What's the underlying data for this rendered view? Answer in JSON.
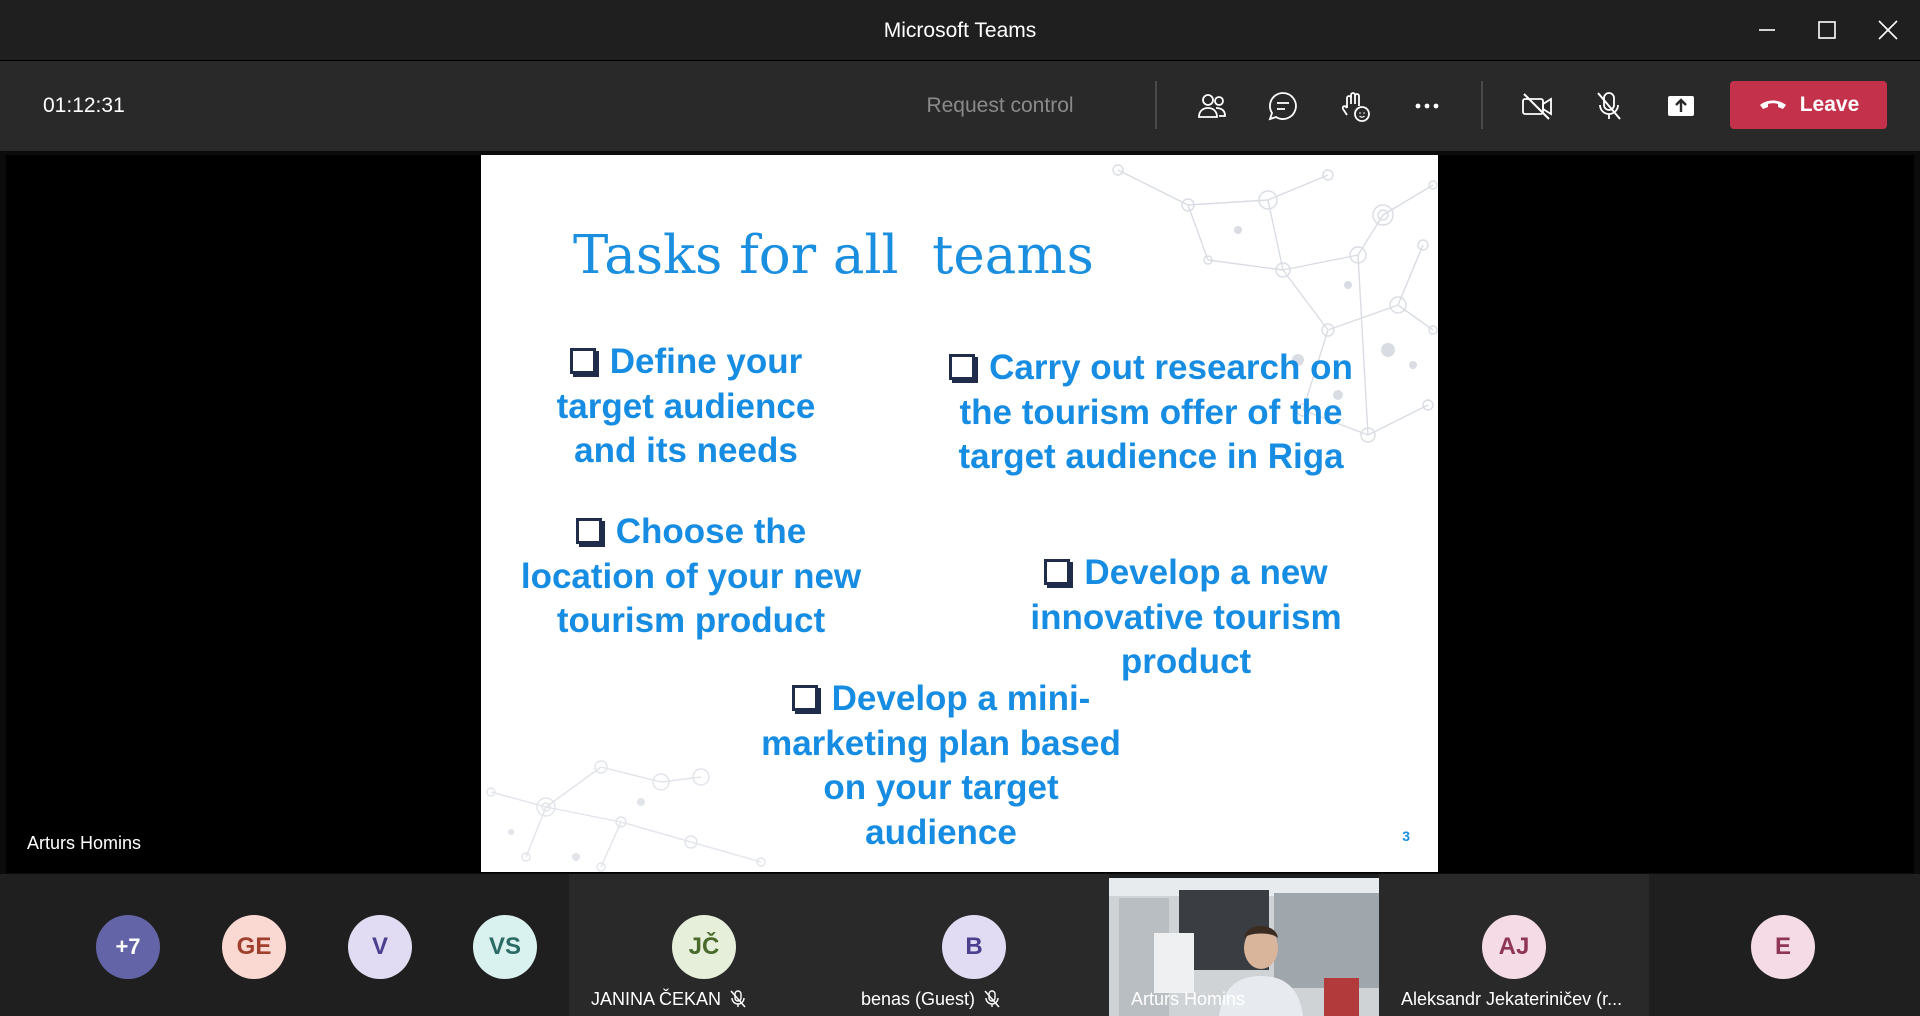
{
  "window": {
    "title": "Microsoft Teams"
  },
  "toolbar": {
    "timer": "01:12:31",
    "request_control": "Request control",
    "leave_label": "Leave",
    "icons": [
      "participants-icon",
      "chat-icon",
      "reactions-icon",
      "more-icon",
      "camera-off-icon",
      "mic-off-icon",
      "share-icon",
      "phone-icon"
    ]
  },
  "stage": {
    "presenter_name": "Arturs Homins"
  },
  "slide": {
    "title": "Tasks for all  teams",
    "tasks": [
      "Define your target audience and its needs",
      "Carry out research on the tourism offer of the target audience in Riga",
      "Choose the location of your new tourism product",
      "Develop a new innovative tourism product",
      "Develop a mini-marketing plan based on your target audience"
    ],
    "page_number": "3",
    "colors": {
      "heading": "#1a8fe0",
      "bullet_text": "#168de2"
    }
  },
  "participants": {
    "overflow": {
      "initials": "+7",
      "color": "#6264a7"
    },
    "list": [
      {
        "initials": "GE",
        "bg": "#fbd9d3",
        "fg": "#a13f2e"
      },
      {
        "initials": "V",
        "bg": "#e1dcf3",
        "fg": "#4b3f8f"
      },
      {
        "initials": "VS",
        "bg": "#d9f2f0",
        "fg": "#2c6a66"
      },
      {
        "initials": "JČ",
        "bg": "#e5efd9",
        "fg": "#4a6a2c",
        "name": "JANINA ČEKAN"
      },
      {
        "initials": "B",
        "bg": "#e1dcf3",
        "fg": "#4b3f8f",
        "name": "benas (Guest)"
      },
      {
        "initials": "",
        "name": "Arturs Homins"
      },
      {
        "initials": "AJ",
        "bg": "#f5dbe5",
        "fg": "#8f3556",
        "name": "Aleksandr Jekateriničev (r..."
      },
      {
        "initials": "E",
        "bg": "#f5dbe5",
        "fg": "#8f3556"
      }
    ]
  },
  "theme": {
    "titlebar": "#1f1f1f",
    "toolbar": "#292929",
    "leave": "#c4314b"
  }
}
